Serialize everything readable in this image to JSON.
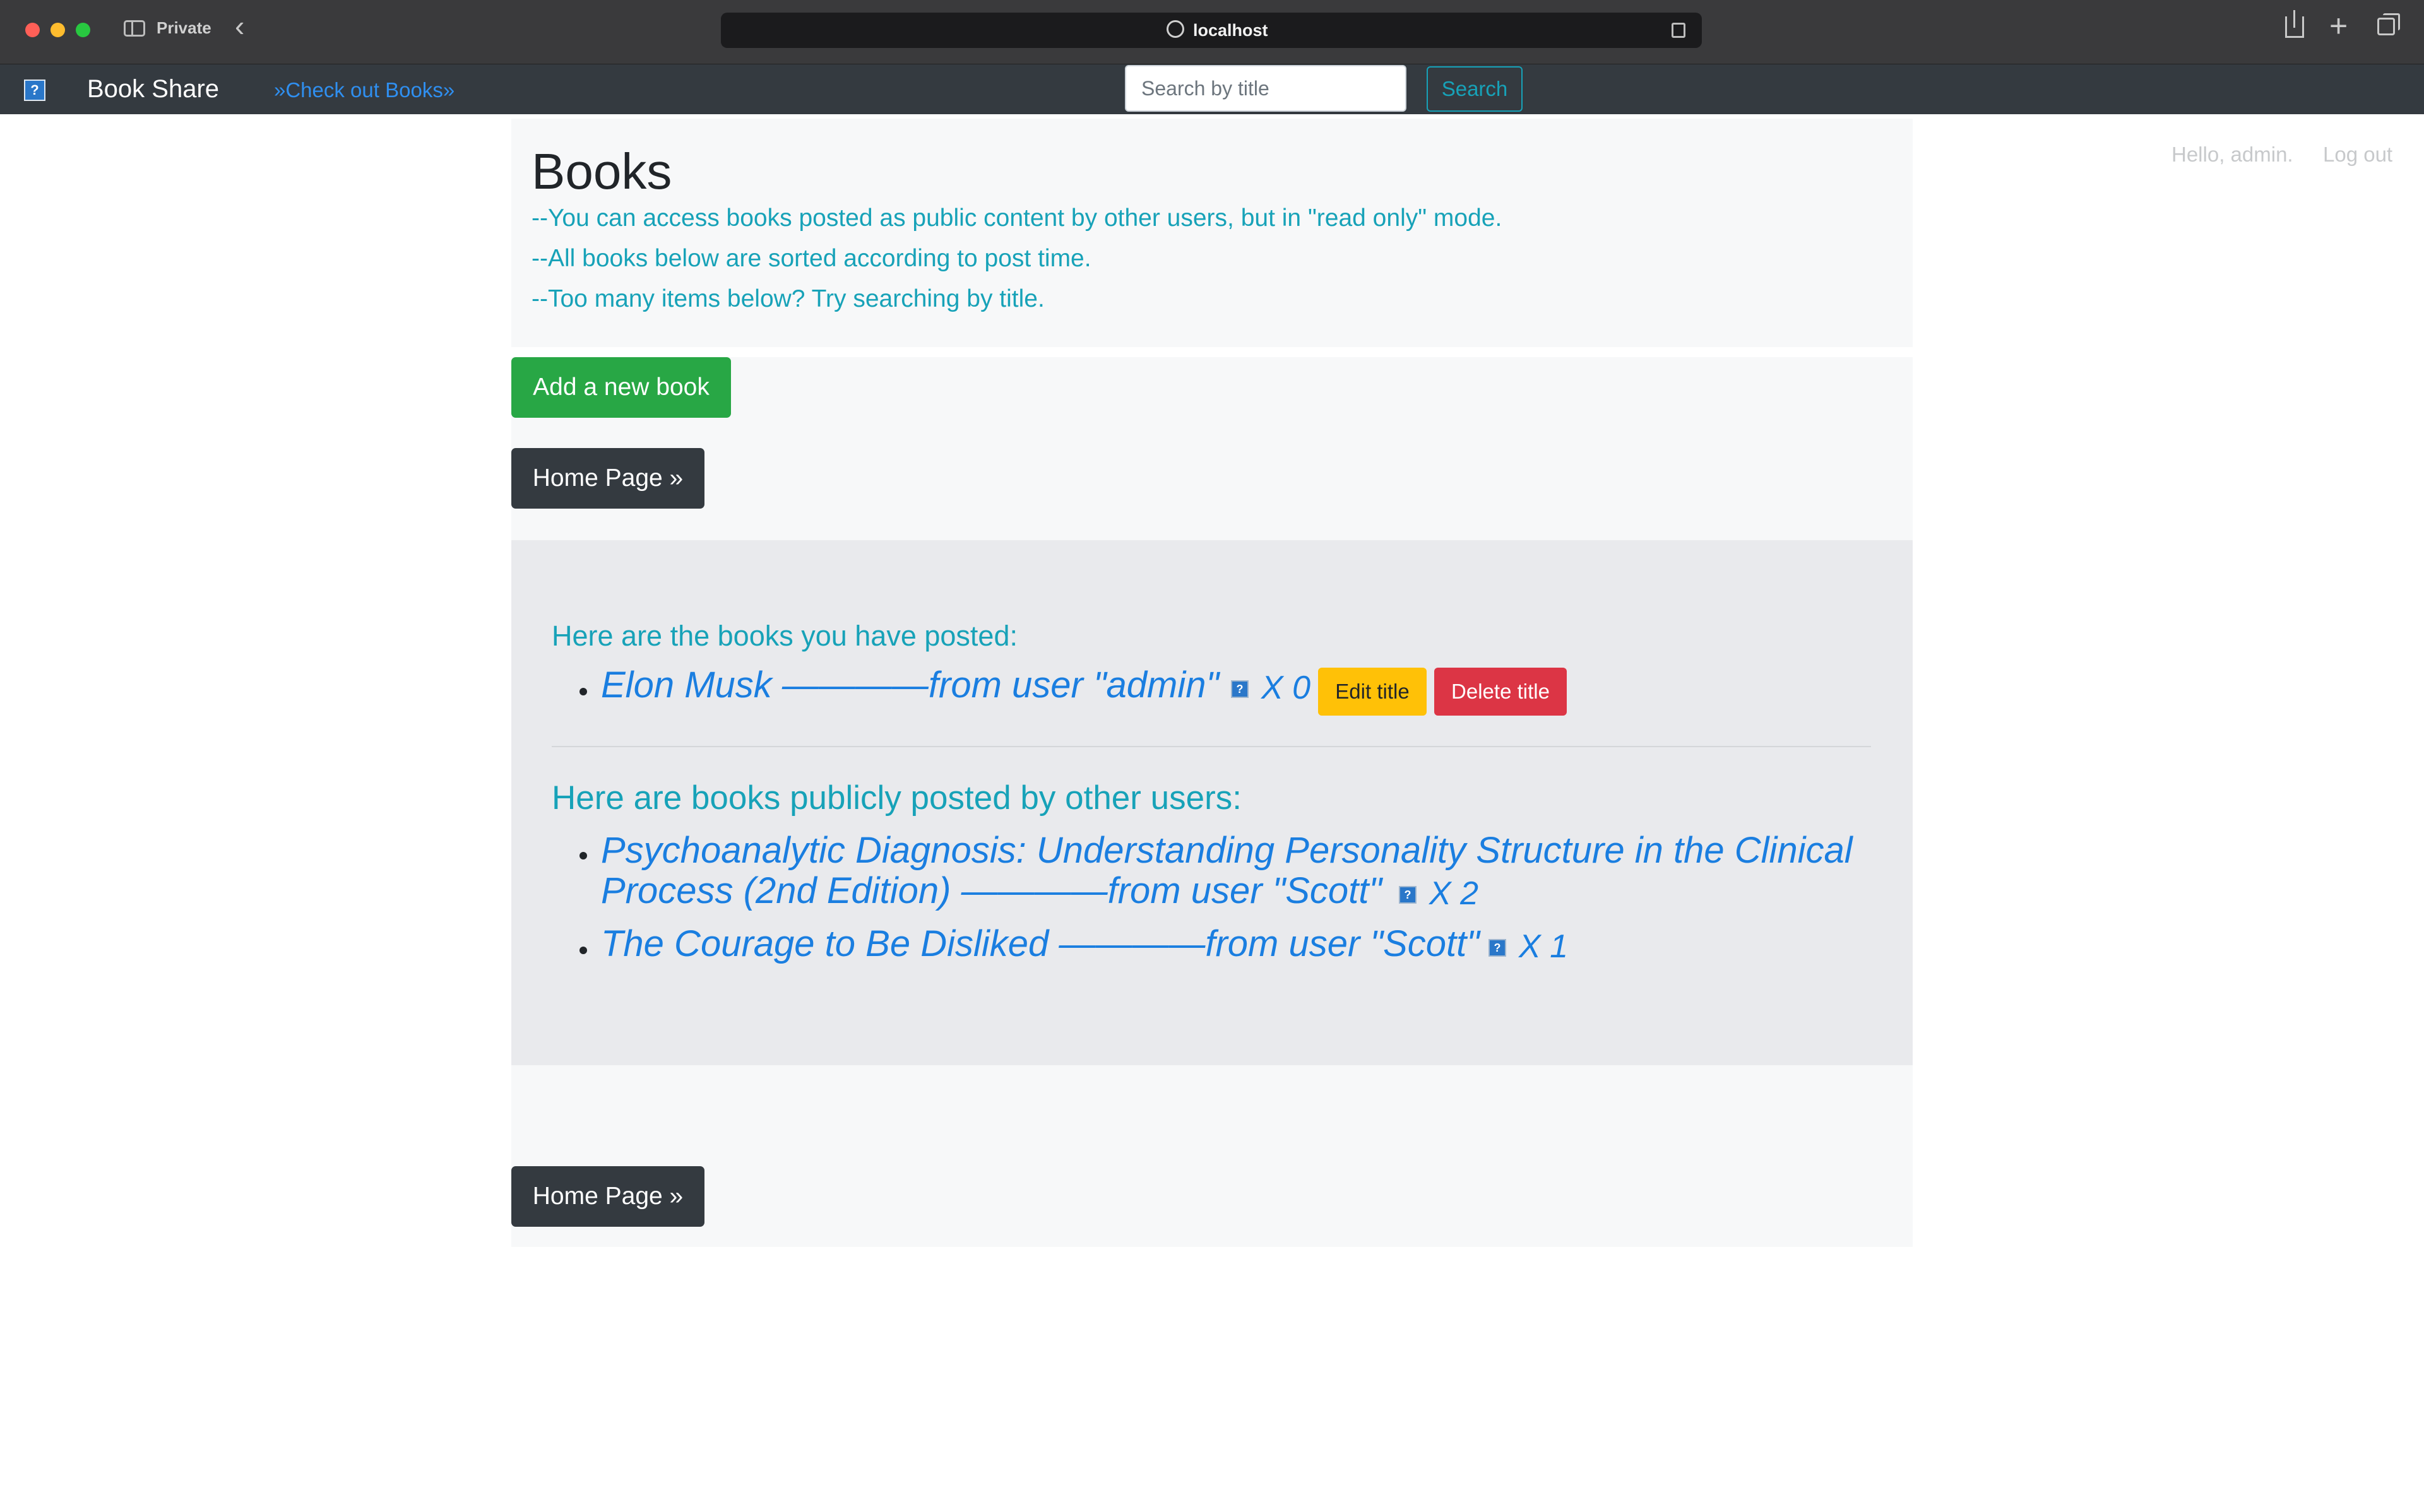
{
  "browser": {
    "private_label": "Private",
    "url": "localhost"
  },
  "navbar": {
    "brand": "Book Share",
    "check_out_link": "»Check out Books»",
    "search_placeholder": "Search by title",
    "search_button": "Search",
    "greeting": "Hello, admin.",
    "logout": "Log out"
  },
  "page": {
    "title": "Books",
    "notes": [
      "--You can access books posted as public content by other users, but in \"read only\" mode.",
      "--All books below are sorted according to post time.",
      "--Too many items below? Try searching by title."
    ],
    "add_button": "Add a new book",
    "home_button": "Home Page »"
  },
  "my_books": {
    "heading": "Here are the books you have posted:",
    "items": [
      {
        "title": "Elon Musk ————from user \"admin\"",
        "count": "X 0",
        "edit_label": "Edit title",
        "delete_label": "Delete title"
      }
    ]
  },
  "public_books": {
    "heading": "Here are books publicly posted by other users:",
    "items": [
      {
        "title_line1": "Psychoanalytic Diagnosis: Understanding Personality Structure in the Clinical",
        "title_line2": "Process (2nd Edition) ————from user \"Scott\"",
        "count": "X 2"
      },
      {
        "title": "The Courage to Be Disliked ————from user \"Scott\"",
        "count": "X 1"
      }
    ]
  },
  "colors": {
    "navbar_bg": "#343a40",
    "accent_teal": "#17a2b8",
    "link_blue": "#1a7ee0",
    "success_green": "#28a745",
    "warning_yellow": "#ffc107",
    "danger_red": "#dc3545"
  }
}
